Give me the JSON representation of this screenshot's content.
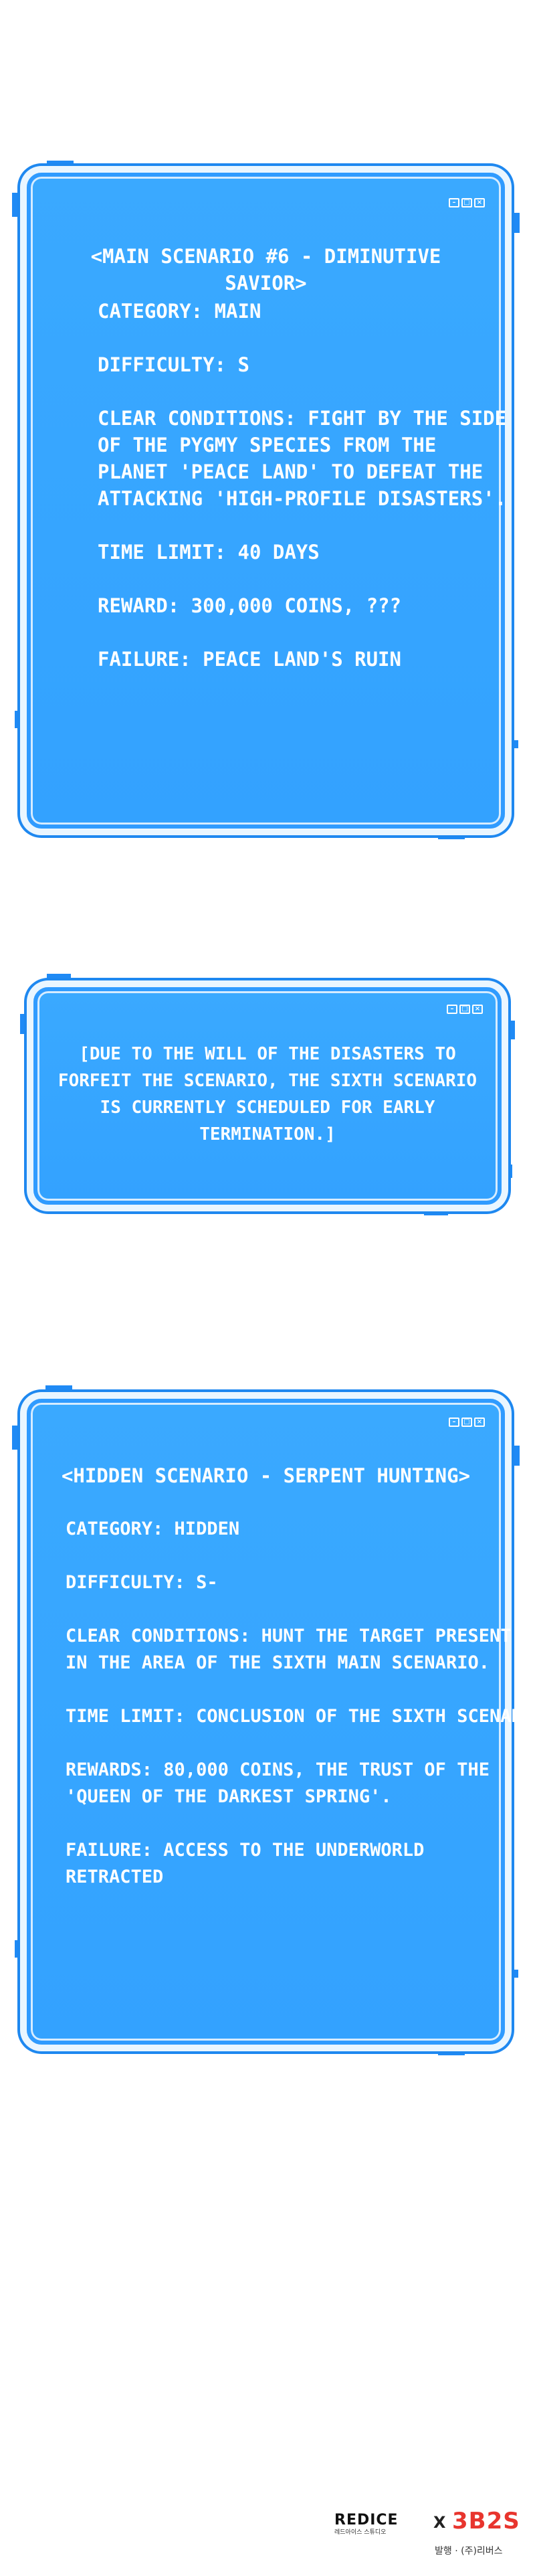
{
  "panel1": {
    "title": "<MAIN SCENARIO #6 - DIMINUTIVE SAVIOR>",
    "title_lines": [
      "<MAIN SCENARIO #6 - DIMINUTIVE",
      "SAVIOR>"
    ],
    "category": "CATEGORY: MAIN",
    "difficulty": "DIFFICULTY: S",
    "clear_lines": [
      "CLEAR CONDITIONS: FIGHT BY THE SIDE",
      "OF THE PYGMY SPECIES FROM THE",
      "PLANET 'PEACE LAND' TO DEFEAT THE",
      "ATTACKING 'HIGH-PROFILE DISASTERS'."
    ],
    "time_limit": "TIME LIMIT: 40 DAYS",
    "reward": "REWARD: 300,000 COINS, ???",
    "failure": "FAILURE: PEACE LAND'S RUIN"
  },
  "panel2": {
    "lines": [
      "[DUE TO THE WILL OF THE DISASTERS TO",
      "FORFEIT THE SCENARIO, THE SIXTH SCENARIO",
      "IS CURRENTLY SCHEDULED FOR EARLY",
      "TERMINATION.]"
    ]
  },
  "panel3": {
    "title": "<HIDDEN SCENARIO - SERPENT HUNTING>",
    "category": "CATEGORY: HIDDEN",
    "difficulty": "DIFFICULTY: S-",
    "clear_lines": [
      "CLEAR CONDITIONS: HUNT THE TARGET PRESENT",
      "IN THE AREA OF THE SIXTH MAIN SCENARIO."
    ],
    "time_limit": "TIME LIMIT: CONCLUSION OF THE SIXTH SCENARIO",
    "reward_lines": [
      "REWARDS: 80,000 COINS, THE TRUST OF THE",
      "'QUEEN OF THE DARKEST SPRING'."
    ],
    "failure_lines": [
      "FAILURE: ACCESS TO THE UNDERWORLD",
      "RETRACTED"
    ]
  },
  "footer": {
    "logo_left": "REDICE",
    "logo_left_sub": "레드아이스 스튜디오",
    "cross": "X",
    "logo_right": "3B2S",
    "publisher": "발행 · (주)리버스"
  },
  "colors": {
    "panel_blue": "#35a4ff",
    "frame_blue": "#1e88f0",
    "text": "#ffffff",
    "logo_red": "#e8352e"
  },
  "icons": [
    "minimize-icon",
    "maximize-icon",
    "close-icon"
  ]
}
